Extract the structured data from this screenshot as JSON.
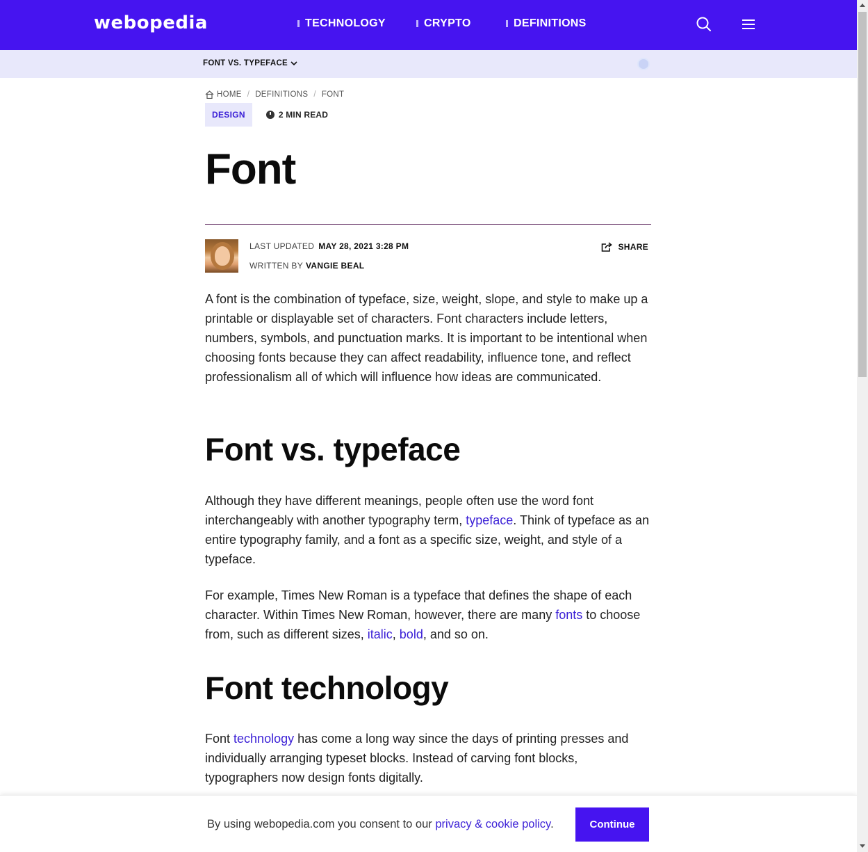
{
  "header": {
    "logo": "webopedia",
    "nav": [
      {
        "label": "TECHNOLOGY"
      },
      {
        "label": "CRYPTO"
      },
      {
        "label": "DEFINITIONS"
      }
    ],
    "search_icon": "search-icon",
    "menu_icon": "hamburger-menu-icon",
    "accent": "#4614f0"
  },
  "subnav": {
    "toc_label": "FONT VS. TYPEFACE"
  },
  "breadcrumb": {
    "home": "HOME",
    "definitions": "DEFINITIONS",
    "current": "FONT",
    "sep": "/"
  },
  "article": {
    "category": "DESIGN",
    "read_time": "2 MIN READ",
    "title": "Font",
    "last_updated_label": "LAST UPDATED",
    "last_updated": "MAY 28, 2021 3:28 PM",
    "written_by_label": "WRITTEN BY",
    "author": "VANGIE BEAL",
    "share_label": "SHARE",
    "intro": "A font is the combination of typeface, size, weight, slope, and style to make up a printable or displayable set of characters. Font characters include letters, numbers, symbols, and punctuation marks. It is important to be intentional when choosing fonts because they can affect readability, influence tone, and reflect professionalism all of which will influence how ideas are communicated.",
    "h2_1": "Font vs. typeface",
    "p2_a": "Although they have different meanings, people often use the word font interchangeably with another typography term, ",
    "p2_link": "typeface",
    "p2_b": ". Think of typeface as an entire typography family, and a font as a specific size, weight, and style of a typeface.",
    "p3_a": "For example, Times New Roman is a typeface that defines the shape of each character. Within Times New Roman, however, there are many ",
    "p3_link1": "fonts",
    "p3_b": " to choose from, such as different sizes, ",
    "p3_link2": "italic",
    "p3_c": ", ",
    "p3_link3": "bold",
    "p3_d": ", and so on.",
    "h2_2": "Font technology",
    "p4_a": "Font ",
    "p4_link": "technology",
    "p4_b": " has come a long way since the days of printing presses and individually arranging typeset blocks. Instead of carving font blocks, typographers now design fonts digitally."
  },
  "cookie": {
    "text": "By using webopedia.com you consent to our ",
    "link": "privacy & cookie policy",
    "end": ".",
    "button": "Continue"
  }
}
